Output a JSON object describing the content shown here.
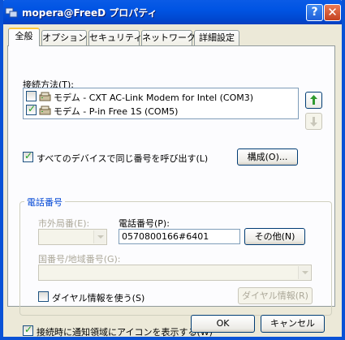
{
  "window": {
    "title": "mopera@FreeD プロパティ"
  },
  "tabs": [
    "全般",
    "オプション",
    "セキュリティ",
    "ネットワーク",
    "詳細設定"
  ],
  "connect_using": {
    "label": "接続方法(T):",
    "devices": [
      {
        "label": "モデム - CXT AC-Link Modem for Intel (COM3)",
        "checked": false
      },
      {
        "label": "モデム - P-in Free 1S (COM5)",
        "checked": true
      }
    ]
  },
  "all_devices_checkbox": {
    "label": "すべてのデバイスで同じ番号を呼び出す(L)",
    "checked": true
  },
  "configure_button": "構成(O)...",
  "phone_group": {
    "title": "電話番号",
    "area_code_label": "市外局番(E):",
    "phone_number_label": "電話番号(P):",
    "phone_number_value": "0570800166#6401",
    "alternates_button": "その他(N)",
    "country_label": "国番号/地域番号(G):",
    "dialing_rules_label": "ダイヤル情報を使う(S)",
    "dialing_rules_checked": false,
    "dialing_rules_button": "ダイヤル情報(R)"
  },
  "show_icon_checkbox": {
    "label": "接続時に通知領域にアイコンを表示する(W)",
    "checked": true
  },
  "footer": {
    "ok": "OK",
    "cancel": "キャンセル"
  },
  "colors": {
    "title_bar": "#0054e3",
    "dialog_bg": "#ece9d8",
    "group_title": "#0046d5"
  },
  "icons": {
    "up": "green-up-arrow-icon",
    "down": "down-arrow-icon",
    "modem": "modem-icon"
  }
}
